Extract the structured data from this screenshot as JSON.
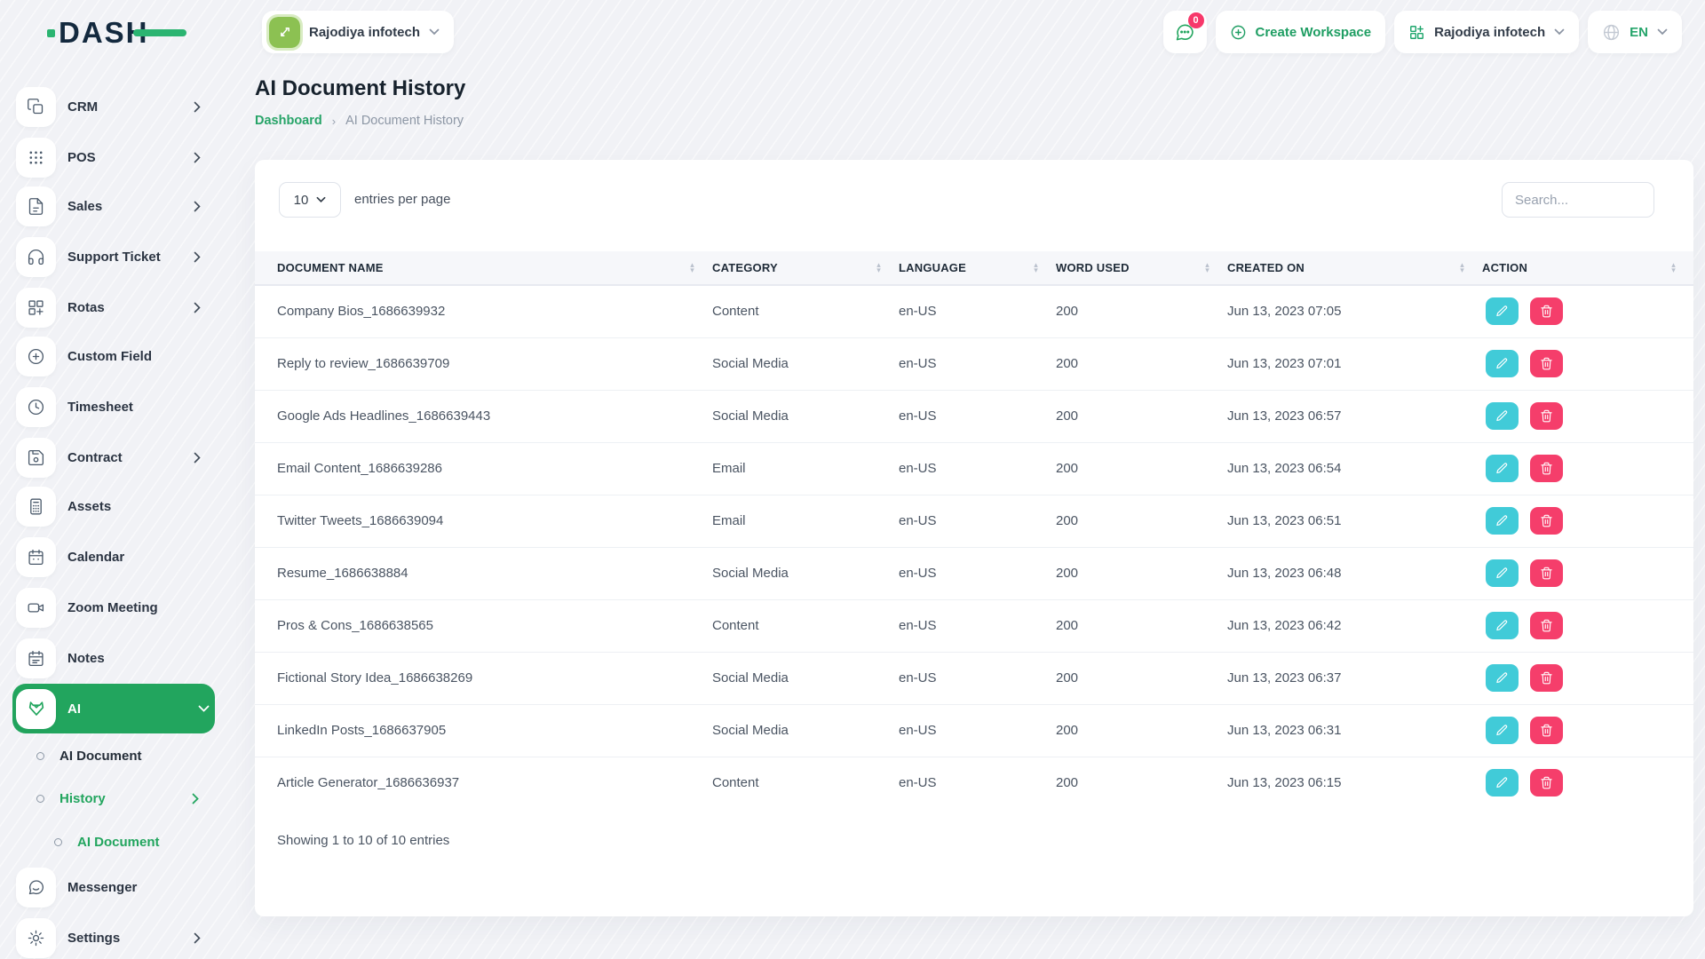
{
  "header": {
    "logo_text": "DASH",
    "workspace_switcher": {
      "label": "Rajodiya infotech"
    },
    "chat_badge": "0",
    "create_workspace_label": "Create Workspace",
    "workspace_menu_label": "Rajodiya infotech",
    "language": "EN"
  },
  "sidebar": {
    "items": [
      {
        "label": "CRM",
        "icon": "crm-icon",
        "has_chevron": true
      },
      {
        "label": "POS",
        "icon": "pos-grid-icon",
        "has_chevron": true
      },
      {
        "label": "Sales",
        "icon": "document-icon",
        "has_chevron": true
      },
      {
        "label": "Support Ticket",
        "icon": "headphones-icon",
        "has_chevron": true
      },
      {
        "label": "Rotas",
        "icon": "grid-plus-icon",
        "has_chevron": true
      },
      {
        "label": "Custom Field",
        "icon": "plus-circle-icon",
        "has_chevron": false
      },
      {
        "label": "Timesheet",
        "icon": "clock-icon",
        "has_chevron": false
      },
      {
        "label": "Contract",
        "icon": "contract-icon",
        "has_chevron": true
      },
      {
        "label": "Assets",
        "icon": "calculator-icon",
        "has_chevron": false
      },
      {
        "label": "Calendar",
        "icon": "calendar-icon",
        "has_chevron": false
      },
      {
        "label": "Zoom Meeting",
        "icon": "video-icon",
        "has_chevron": false
      },
      {
        "label": "Notes",
        "icon": "notes-icon",
        "has_chevron": false
      },
      {
        "label": "AI",
        "icon": "ai-fox-icon",
        "active": true,
        "has_chevron": true
      },
      {
        "label": "AI Document",
        "sub": true,
        "active": false
      },
      {
        "label": "History",
        "sub": true,
        "active": true,
        "has_chevron": true
      },
      {
        "label": "AI Document",
        "sub_nested": true,
        "active": true
      },
      {
        "label": "Messenger",
        "icon": "chat-bubble-icon",
        "has_chevron": false
      },
      {
        "label": "Settings",
        "icon": "gear-icon",
        "has_chevron": true
      }
    ]
  },
  "page": {
    "title": "AI Document History",
    "breadcrumb": {
      "home": "Dashboard",
      "separator": "›",
      "current": "AI Document History"
    }
  },
  "table_controls": {
    "entries_per_page_value": "10",
    "entries_per_page_label": "entries per page",
    "search_placeholder": "Search..."
  },
  "table": {
    "columns": [
      "DOCUMENT NAME",
      "CATEGORY",
      "LANGUAGE",
      "WORD USED",
      "CREATED ON",
      "ACTION"
    ],
    "rows": [
      {
        "document_name": "Company Bios_1686639932",
        "category": "Content",
        "language": "en-US",
        "word_used": "200",
        "created_on": "Jun 13, 2023 07:05"
      },
      {
        "document_name": "Reply to review_1686639709",
        "category": "Social Media",
        "language": "en-US",
        "word_used": "200",
        "created_on": "Jun 13, 2023 07:01"
      },
      {
        "document_name": "Google Ads Headlines_1686639443",
        "category": "Social Media",
        "language": "en-US",
        "word_used": "200",
        "created_on": "Jun 13, 2023 06:57"
      },
      {
        "document_name": "Email Content_1686639286",
        "category": "Email",
        "language": "en-US",
        "word_used": "200",
        "created_on": "Jun 13, 2023 06:54"
      },
      {
        "document_name": "Twitter Tweets_1686639094",
        "category": "Email",
        "language": "en-US",
        "word_used": "200",
        "created_on": "Jun 13, 2023 06:51"
      },
      {
        "document_name": "Resume_1686638884",
        "category": "Social Media",
        "language": "en-US",
        "word_used": "200",
        "created_on": "Jun 13, 2023 06:48"
      },
      {
        "document_name": "Pros & Cons_1686638565",
        "category": "Content",
        "language": "en-US",
        "word_used": "200",
        "created_on": "Jun 13, 2023 06:42"
      },
      {
        "document_name": "Fictional Story Idea_1686638269",
        "category": "Social Media",
        "language": "en-US",
        "word_used": "200",
        "created_on": "Jun 13, 2023 06:37"
      },
      {
        "document_name": "LinkedIn Posts_1686637905",
        "category": "Social Media",
        "language": "en-US",
        "word_used": "200",
        "created_on": "Jun 13, 2023 06:31"
      },
      {
        "document_name": "Article Generator_1686636937",
        "category": "Content",
        "language": "en-US",
        "word_used": "200",
        "created_on": "Jun 13, 2023 06:15"
      }
    ],
    "footer": "Showing 1 to 10 of 10 entries"
  },
  "colors": {
    "accent_green": "#22a55e",
    "workspace_avatar_green": "#8cc152",
    "logo_navy": "#13293e",
    "edit_button_cyan": "#41cbd8",
    "delete_button_pink": "#f53e6b",
    "badge_pink": "#f7386a"
  }
}
